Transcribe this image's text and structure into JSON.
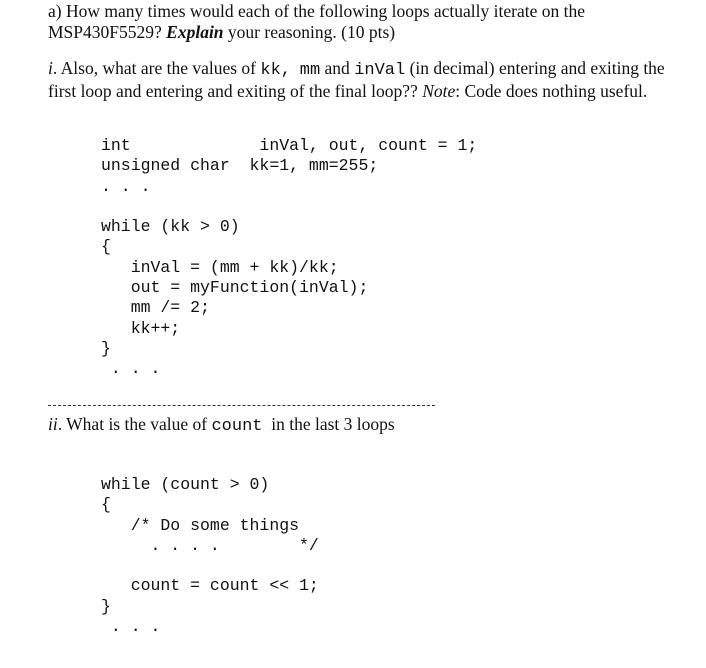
{
  "question_a": {
    "line1": "a) How many times would each of the following loops actually iterate on the",
    "line2_prefix": "MSP430F5529?  ",
    "line2_bold": "Explain",
    "line2_suffix": " your reasoning.  (10 pts)"
  },
  "question_i": {
    "label": "i",
    "text1": ". Also, what are the values of ",
    "var1": "kk,",
    "var2": "mm",
    "text2": " and ",
    "var3": "inVal",
    "text3": " (in decimal) entering and exiting the first loop and entering and exiting of the final loop??  ",
    "note_label": "Note",
    "note_text": ": Code does nothing useful."
  },
  "code_block_1": {
    "lines": [
      "int             inVal, out, count = 1;",
      "unsigned char  kk=1, mm=255;",
      ". . .",
      "",
      "while (kk > 0)",
      "{",
      "   inVal = (mm + kk)/kk;",
      "   out = myFunction(inVal);",
      "   mm /= 2;",
      "   kk++;",
      "}",
      " . . ."
    ]
  },
  "question_ii": {
    "label": "ii",
    "text1": ".  What is the value of ",
    "var": "count",
    "text2": "  in the last 3 loops"
  },
  "code_block_2": {
    "lines": [
      "while (count > 0)",
      "{",
      "   /* Do some things",
      "     . . . .        */",
      "",
      "   count = count << 1;",
      "}",
      " . . ."
    ]
  }
}
